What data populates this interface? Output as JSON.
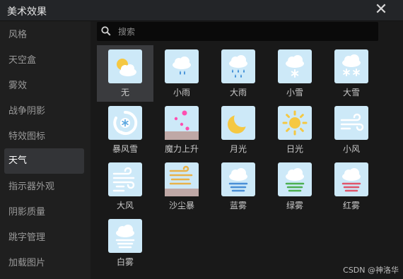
{
  "window": {
    "title": "美术效果",
    "close_icon": "close-icon"
  },
  "sidebar": {
    "items": [
      {
        "label": "风格"
      },
      {
        "label": "天空盒"
      },
      {
        "label": "雾效"
      },
      {
        "label": "战争阴影"
      },
      {
        "label": "特效图标"
      },
      {
        "label": "天气",
        "active": true
      },
      {
        "label": "指示器外观"
      },
      {
        "label": "阴影质量"
      },
      {
        "label": "跳字管理"
      },
      {
        "label": "加载图片"
      }
    ]
  },
  "search": {
    "placeholder": "搜索",
    "value": "",
    "icon": "search-icon"
  },
  "weather": {
    "items": [
      {
        "label": "无",
        "icon": "sun-cloud-icon",
        "selected": true
      },
      {
        "label": "小雨",
        "icon": "light-rain-icon"
      },
      {
        "label": "大雨",
        "icon": "heavy-rain-icon"
      },
      {
        "label": "小雪",
        "icon": "light-snow-icon"
      },
      {
        "label": "大雪",
        "icon": "heavy-snow-icon"
      },
      {
        "label": "暴风雪",
        "icon": "blizzard-icon"
      },
      {
        "label": "魔力上升",
        "icon": "magic-rise-icon"
      },
      {
        "label": "月光",
        "icon": "moon-icon"
      },
      {
        "label": "日光",
        "icon": "sun-icon"
      },
      {
        "label": "小风",
        "icon": "light-wind-icon"
      },
      {
        "label": "大风",
        "icon": "strong-wind-icon"
      },
      {
        "label": "沙尘暴",
        "icon": "sandstorm-icon"
      },
      {
        "label": "蓝雾",
        "icon": "blue-fog-icon"
      },
      {
        "label": "绿雾",
        "icon": "green-fog-icon"
      },
      {
        "label": "红雾",
        "icon": "red-fog-icon"
      },
      {
        "label": "白雾",
        "icon": "white-fog-icon"
      }
    ]
  },
  "colors": {
    "icon_bg": "#cde9f8",
    "rain": "#3f8ed6",
    "sun": "#f5c842",
    "fog_blue": "#4a8fd6",
    "fog_green": "#4caf50",
    "fog_red": "#e0556a",
    "sand": "#e8b24a",
    "magic": "#ff4fb0"
  },
  "watermark": "CSDN @神洛华"
}
